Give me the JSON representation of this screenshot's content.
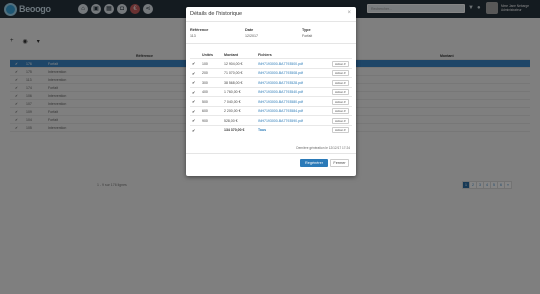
{
  "app": {
    "logo_text": "Beoogo",
    "search_placeholder": "Rechercher...",
    "user_name": "Mme Jane Nebarge",
    "user_role": "Administrateur"
  },
  "toolbar": {
    "icons": [
      "plus-icon",
      "user-icon",
      "filter-icon"
    ]
  },
  "background_table": {
    "rows": [
      {
        "id": "176",
        "label": "Forfait",
        "selected": true
      },
      {
        "id": "175",
        "label": "Intervention"
      },
      {
        "id": "113",
        "label": "Intervention"
      },
      {
        "id": "174",
        "label": "Forfait"
      },
      {
        "id": "106",
        "label": "Intervention"
      },
      {
        "id": "107",
        "label": "Intervention"
      },
      {
        "id": "109",
        "label": "Forfait"
      },
      {
        "id": "104",
        "label": "Forfait"
      },
      {
        "id": "105",
        "label": "Intervention"
      }
    ],
    "footer_note": "1 - 9 sur 176 lignes",
    "pages": [
      "1",
      "2",
      "3",
      "4",
      "5",
      "6",
      "»"
    ]
  },
  "modal": {
    "title": "Détails de l'historique",
    "close": "×",
    "reference_label": "Référence",
    "reference_value": "113",
    "date_label": "Date",
    "date_value": "12/2017",
    "type_label": "Type",
    "type_value": "Forfait",
    "columns": {
      "units": "Unités",
      "amount": "Montant",
      "files": "Fichiers"
    },
    "rows": [
      {
        "units": "100",
        "amount": "12 904,00 €",
        "file": "INH7193000-BA7793500.pdf",
        "action": "Action ▾"
      },
      {
        "units": "200",
        "amount": "71 070,00 €",
        "file": "INH7193000-BA7793508.pdf",
        "action": "Action ▾"
      },
      {
        "units": "300",
        "amount": "38 568,00 €",
        "file": "INH7193000-BA7793528.pdf",
        "action": "Action ▾"
      },
      {
        "units": "400",
        "amount": "1 760,00 €",
        "file": "INH7193000-BA7793540.pdf",
        "action": "Action ▾"
      },
      {
        "units": "500",
        "amount": "7 040,00 €",
        "file": "INH7193000-BA7793580.pdf",
        "action": "Action ▾"
      },
      {
        "units": "600",
        "amount": "2 200,00 €",
        "file": "INH7193000-BA7793584.pdf",
        "action": "Action ▾"
      },
      {
        "units": "900",
        "amount": "528,00 €",
        "file": "INH7193000-BA7793590.pdf",
        "action": "Action ▾"
      }
    ],
    "total": {
      "amount": "134 370,00 €",
      "file": "Tous",
      "action": "Action ▾"
    },
    "generated_note": "Dernière génération le 12/12/17 17:24",
    "regenerate_label": "Regénérer",
    "close_label": "Fermer"
  }
}
